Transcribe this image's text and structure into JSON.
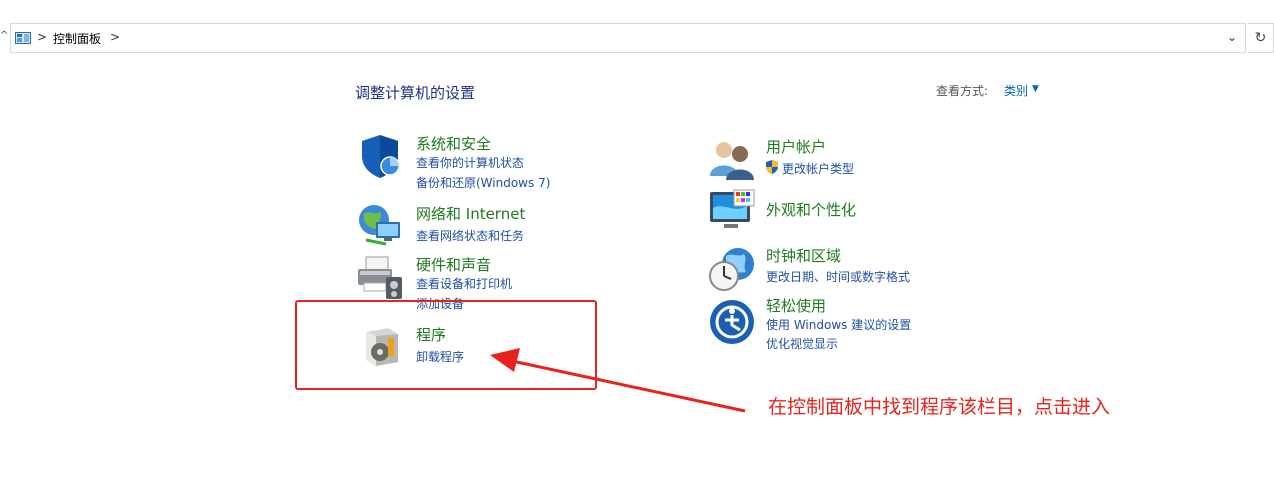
{
  "address_bar": {
    "breadcrumb": "控制面板",
    "separator": ">",
    "dropdown_glyph": "⌄",
    "refresh_glyph": "↻",
    "back_glyph": "^"
  },
  "header": {
    "title": "调整计算机的设置",
    "view_by_label": "查看方式:",
    "view_by_value": "类别",
    "view_by_caret": "▼"
  },
  "categories": [
    {
      "title": "系统和安全",
      "links": [
        "查看你的计算机状态",
        "备份和还原(Windows 7)"
      ]
    },
    {
      "title": "网络和 Internet",
      "links": [
        "查看网络状态和任务"
      ]
    },
    {
      "title": "硬件和声音",
      "links": [
        "查看设备和打印机",
        "添加设备"
      ]
    },
    {
      "title": "程序",
      "links": [
        "卸载程序"
      ]
    },
    {
      "title": "用户帐户",
      "links": [
        "更改帐户类型"
      ]
    },
    {
      "title": "外观和个性化",
      "links": []
    },
    {
      "title": "时钟和区域",
      "links": [
        "更改日期、时间或数字格式"
      ]
    },
    {
      "title": "轻松使用",
      "links": [
        "使用 Windows 建议的设置",
        "优化视觉显示"
      ]
    }
  ],
  "annotation": {
    "text": "在控制面板中找到程序该栏目，点击进入",
    "color": "#e8231b"
  }
}
